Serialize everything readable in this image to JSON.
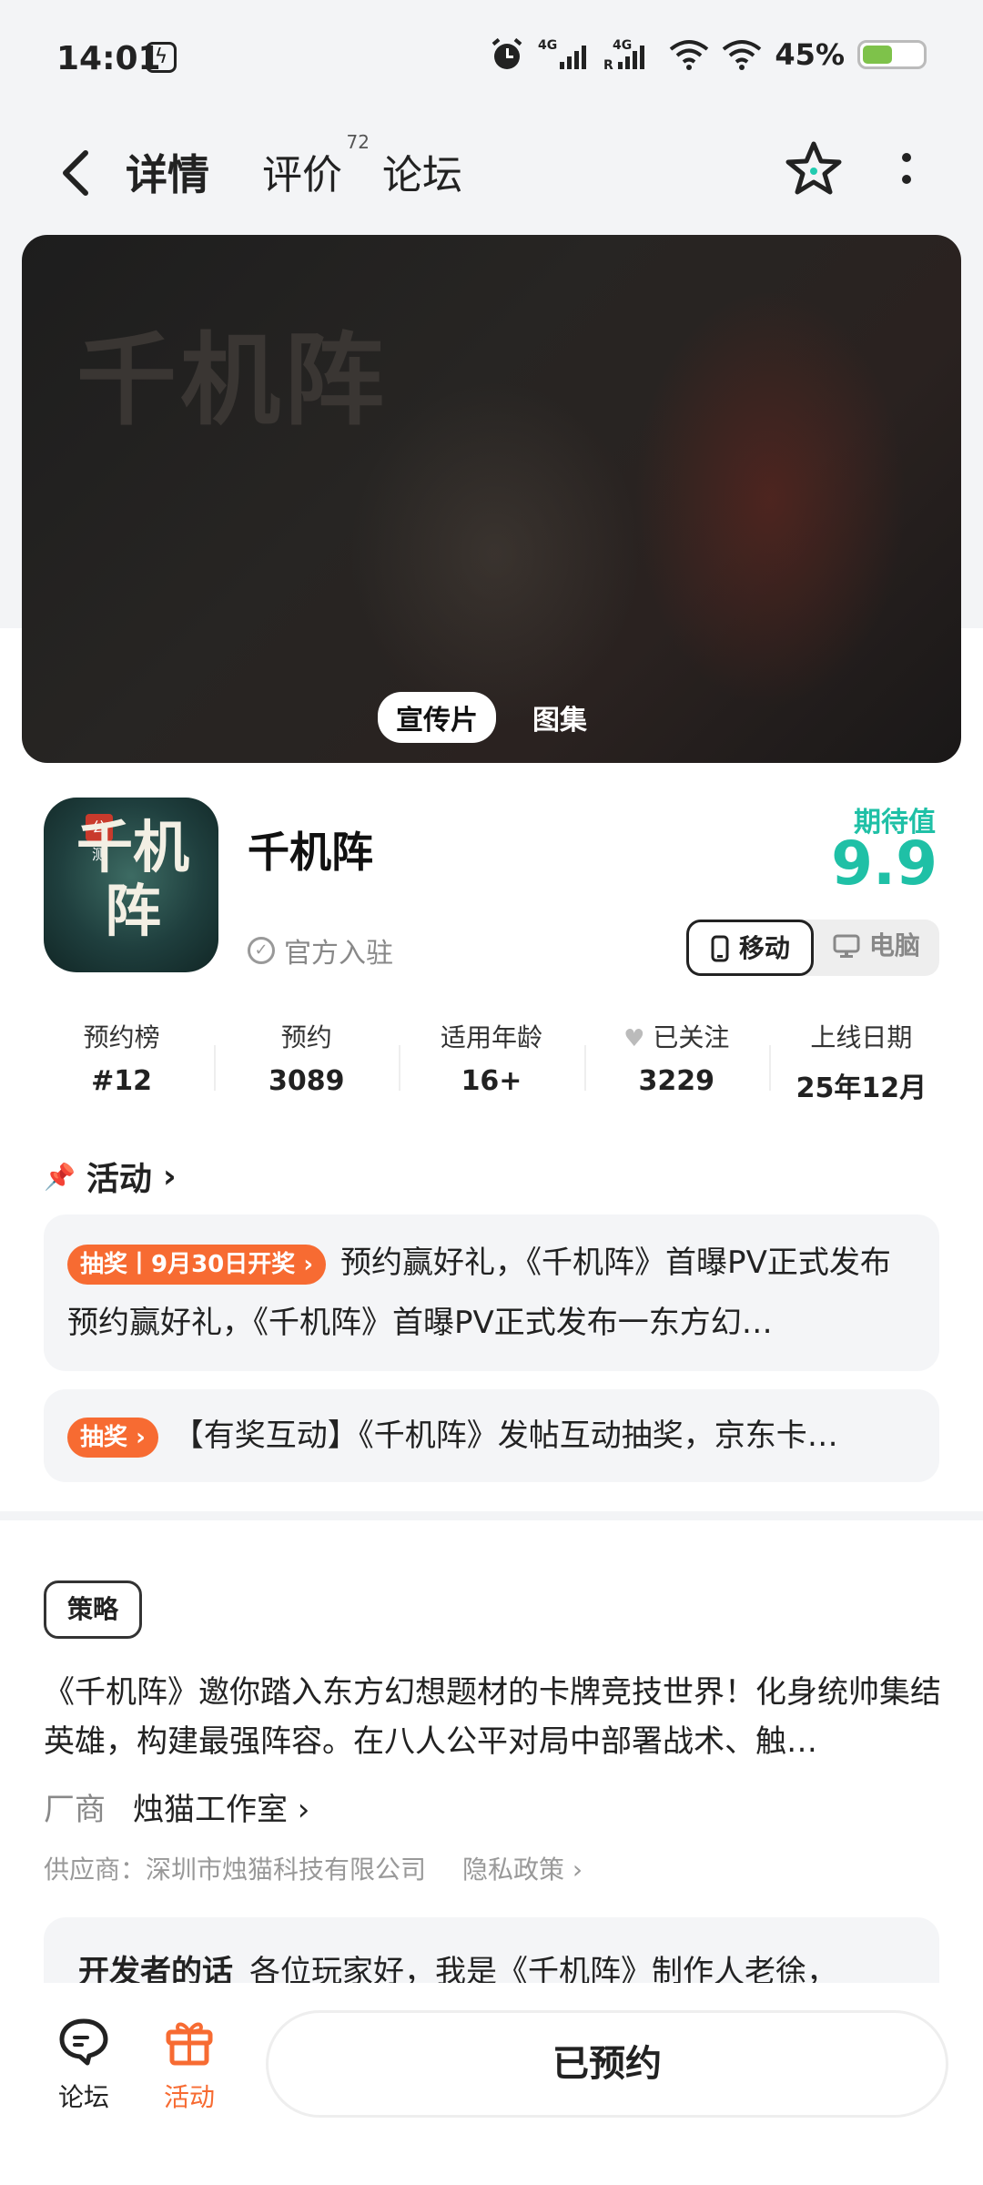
{
  "status_bar": {
    "time": "14:01",
    "battery_percent": "45%",
    "battery_level": 0.45,
    "icons": [
      "alarm-icon",
      "4g-signal-icon",
      "4g-roaming-signal-icon",
      "wifi-icon",
      "wifi-icon"
    ]
  },
  "nav": {
    "tabs": [
      {
        "label": "详情",
        "active": true
      },
      {
        "label": "评价",
        "badge": "72"
      },
      {
        "label": "论坛"
      }
    ],
    "accent_color": "#21cbb0"
  },
  "banner": {
    "logo_text": "千机阵",
    "tabs": [
      {
        "label": "宣传片",
        "active": true
      },
      {
        "label": "图集"
      }
    ]
  },
  "game": {
    "icon_text": "千机阵",
    "icon_seal": "公测",
    "title": "千机阵",
    "official": "官方入驻",
    "expect_label": "期待值",
    "expect_score": "9.9",
    "platforms": [
      "移动",
      "电脑"
    ]
  },
  "stats": [
    {
      "label": "预约榜",
      "value": "#12"
    },
    {
      "label": "预约",
      "value": "3089"
    },
    {
      "label": "适用年龄",
      "value": "16+"
    },
    {
      "label": "已关注",
      "value": "3229"
    },
    {
      "label": "上线日期",
      "value": "25年12月"
    }
  ],
  "activities": {
    "header": "活动",
    "items": [
      {
        "tag": "抽奖丨9月30日开奖",
        "text": "预约赢好礼，《千机阵》首曝PV正式发布 预约赢好礼，《千机阵》首曝PV正式发布一东方幻…"
      },
      {
        "tag": "抽奖",
        "text": "【有奖互动】《千机阵》发帖互动抽奖，京东卡…"
      }
    ]
  },
  "guide": {
    "label": "策略",
    "description": "《千机阵》邀你踏入东方幻想题材的卡牌竞技世界！化身统帅集结英雄，构建最强阵容。在八人公平对局中部署战术、触…"
  },
  "vendor": {
    "label": "厂商",
    "name": "烛猫工作室"
  },
  "supplier": {
    "text": "供应商：深圳市烛猫科技有限公司",
    "privacy": "隐私政策"
  },
  "developer": {
    "label": "开发者的话",
    "text": "各位玩家好，我是《千机阵》制作人老徐，"
  },
  "bottom_nav": {
    "forum": "论坛",
    "activity": "活动",
    "reserved": "已预约",
    "activity_color": "#f76b32"
  }
}
